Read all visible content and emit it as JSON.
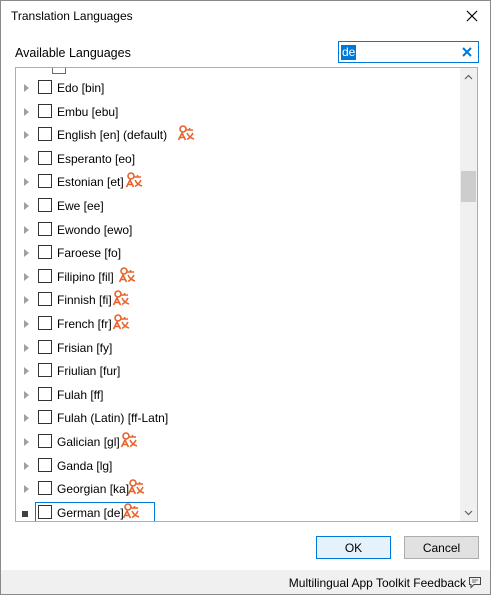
{
  "window": {
    "title": "Translation Languages"
  },
  "filter": {
    "label": "Available Languages",
    "value": "de"
  },
  "languages": [
    {
      "label": "Edo [bin]",
      "translator": false,
      "expanded": false
    },
    {
      "label": "Embu [ebu]",
      "translator": false,
      "expanded": false
    },
    {
      "label": "English [en] (default)",
      "translator": true,
      "expanded": false
    },
    {
      "label": "Esperanto [eo]",
      "translator": false,
      "expanded": false
    },
    {
      "label": "Estonian [et]",
      "translator": true,
      "expanded": false
    },
    {
      "label": "Ewe [ee]",
      "translator": false,
      "expanded": false
    },
    {
      "label": "Ewondo [ewo]",
      "translator": false,
      "expanded": false
    },
    {
      "label": "Faroese [fo]",
      "translator": false,
      "expanded": false
    },
    {
      "label": "Filipino [fil]",
      "translator": true,
      "expanded": false
    },
    {
      "label": "Finnish [fi]",
      "translator": true,
      "expanded": false
    },
    {
      "label": "French [fr]",
      "translator": true,
      "expanded": false
    },
    {
      "label": "Frisian [fy]",
      "translator": false,
      "expanded": false
    },
    {
      "label": "Friulian [fur]",
      "translator": false,
      "expanded": false
    },
    {
      "label": "Fulah [ff]",
      "translator": false,
      "expanded": false
    },
    {
      "label": "Fulah (Latin) [ff-Latn]",
      "translator": false,
      "expanded": false
    },
    {
      "label": "Galician [gl]",
      "translator": true,
      "expanded": false
    },
    {
      "label": "Ganda [lg]",
      "translator": false,
      "expanded": false
    },
    {
      "label": "Georgian [ka]",
      "translator": true,
      "expanded": false
    },
    {
      "label": "German [de]",
      "translator": true,
      "expanded": true,
      "focused": true
    }
  ],
  "buttons": {
    "ok": "OK",
    "cancel": "Cancel"
  },
  "footer": {
    "feedback": "Multilingual App Toolkit Feedback"
  },
  "icons": {
    "close": "close-icon",
    "clear": "clear-search-icon",
    "translator": "machine-translation-icon",
    "feedback": "feedback-speech-icon"
  },
  "colors": {
    "accent": "#0078d7",
    "translator_icon": "#e8622c"
  }
}
